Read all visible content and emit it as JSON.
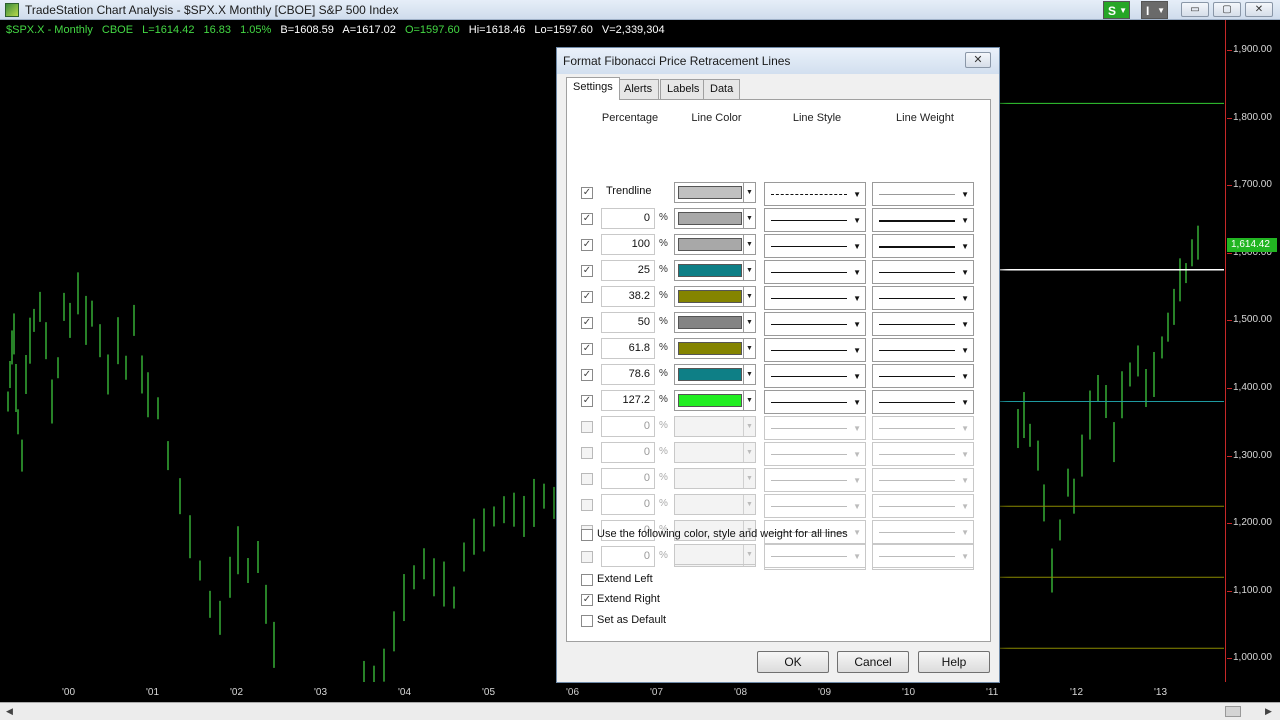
{
  "window": {
    "title": "TradeStation Chart Analysis - $SPX.X Monthly [CBOE] S&P 500 Index",
    "badge_s": "S",
    "badge_i": "I",
    "min_glyph": "▭",
    "max_glyph": "▢",
    "close_glyph": "✕"
  },
  "symbol_bar": {
    "symbol": "$SPX.X - Monthly",
    "exchange": "CBOE",
    "last": "L=1614.42",
    "change": "16.83",
    "change_pct": "1.05%",
    "bid": "B=1608.59",
    "ask": "A=1617.02",
    "open": "O=1597.60",
    "high": "Hi=1618.46",
    "low": "Lo=1597.60",
    "volume": "V=2,339,304"
  },
  "price_axis": {
    "labels": [
      "1,900.00",
      "1,800.00",
      "1,700.00",
      "1,600.00",
      "1,500.00",
      "1,400.00",
      "1,300.00",
      "1,200.00",
      "1,100.00",
      "1,000.00"
    ],
    "last_price": "1,614.42"
  },
  "time_axis": {
    "labels": [
      "'00",
      "'01",
      "'02",
      "'03",
      "'04",
      "'05",
      "'06",
      "'07",
      "'08",
      "'09",
      "'10",
      "'11",
      "'12",
      "'13"
    ]
  },
  "colors": {
    "chart_bars": "#44d944",
    "axis_line": "#c62828",
    "last_price_bg": "#22b522"
  },
  "dialog": {
    "title": "Format Fibonacci Price Retracement Lines",
    "close_glyph": "✕",
    "tabs": [
      "Settings",
      "Alerts",
      "Labels",
      "Data"
    ],
    "headers": {
      "percentage": "Percentage",
      "line_color": "Line Color",
      "line_style": "Line Style",
      "line_weight": "Line Weight"
    },
    "pct_sign": "%",
    "rows": [
      {
        "label": "Trendline",
        "checked": true,
        "color": "#c0c0c0",
        "style": "dashed",
        "weight": 1
      },
      {
        "value": "0",
        "checked": true,
        "color": "#a8a8a8",
        "style": "solid",
        "weight": 2
      },
      {
        "value": "100",
        "checked": true,
        "color": "#a8a8a8",
        "style": "solid",
        "weight": 2
      },
      {
        "value": "25",
        "checked": true,
        "color": "#0e7f86",
        "style": "solid",
        "weight": 1
      },
      {
        "value": "38.2",
        "checked": true,
        "color": "#848400",
        "style": "solid",
        "weight": 1
      },
      {
        "value": "50",
        "checked": true,
        "color": "#848484",
        "style": "solid",
        "weight": 1
      },
      {
        "value": "61.8",
        "checked": true,
        "color": "#848400",
        "style": "solid",
        "weight": 1
      },
      {
        "value": "78.6",
        "checked": true,
        "color": "#0e7f86",
        "style": "solid",
        "weight": 1
      },
      {
        "value": "127.2",
        "checked": true,
        "color": "#22ee22",
        "style": "solid",
        "weight": 1
      },
      {
        "value": "0",
        "checked": false,
        "disabled": true
      },
      {
        "value": "0",
        "checked": false,
        "disabled": true
      },
      {
        "value": "0",
        "checked": false,
        "disabled": true
      },
      {
        "value": "0",
        "checked": false,
        "disabled": true
      },
      {
        "value": "0",
        "checked": false,
        "disabled": true
      },
      {
        "value": "0",
        "checked": false,
        "disabled": true
      }
    ],
    "use_all_label": "Use the following color, style and weight for all lines",
    "extend_left": "Extend Left",
    "extend_left_checked": false,
    "extend_right": "Extend Right",
    "extend_right_checked": true,
    "set_default": "Set as Default",
    "set_default_checked": false,
    "buttons": {
      "ok": "OK",
      "cancel": "Cancel",
      "help": "Help"
    }
  }
}
